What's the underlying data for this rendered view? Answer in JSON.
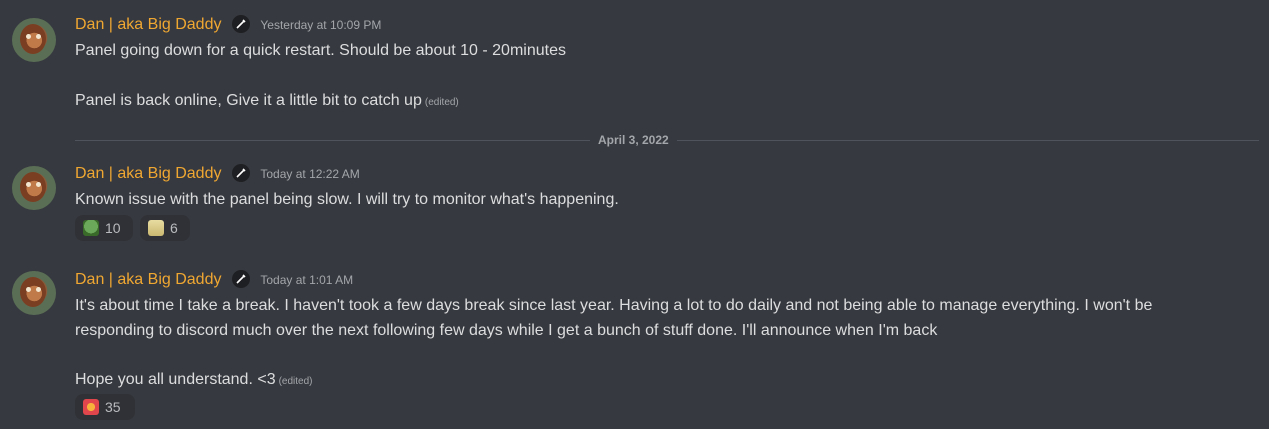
{
  "date_divider": "April 3, 2022",
  "messages": [
    {
      "author": "Dan | aka Big Daddy",
      "timestamp": "Yesterday at 10:09 PM",
      "lines": [
        "Panel going down for a quick restart. Should be about 10 - 20minutes",
        "Panel is back online, Give it a little bit to catch up"
      ],
      "edited_label": "(edited)"
    },
    {
      "author": "Dan | aka Big Daddy",
      "timestamp": "Today at 12:22 AM",
      "lines": [
        "Known issue with the panel being slow. I will try to monitor what's happening."
      ],
      "reactions": [
        {
          "emoji": "frog-emoji",
          "count": "10"
        },
        {
          "emoji": "cat-emoji",
          "count": "6"
        }
      ]
    },
    {
      "author": "Dan | aka Big Daddy",
      "timestamp": "Today at 1:01 AM",
      "lines": [
        "It's about time I take a break. I haven't took a few days break since last year. Having a lot to do daily and not being able to manage everything. I won't be",
        "responding to discord much over the next following few days while I get a bunch of stuff done. I'll announce when I'm back",
        "Hope you all understand. <3"
      ],
      "edited_label": "(edited)",
      "reactions": [
        {
          "emoji": "heart-emoji",
          "count": "35"
        }
      ]
    }
  ],
  "colors": {
    "background": "#36393f",
    "username": "#f0a732",
    "text": "#dcddde",
    "muted": "#a3a6aa"
  }
}
